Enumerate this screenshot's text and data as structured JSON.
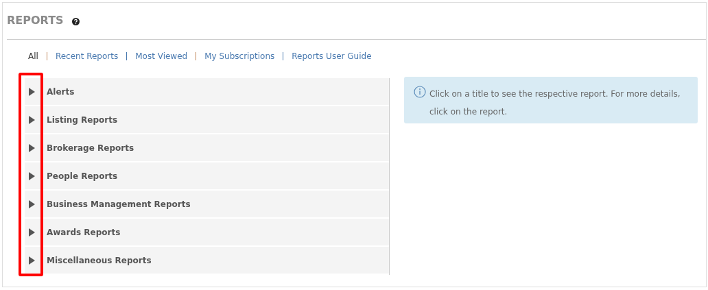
{
  "page": {
    "title": "REPORTS"
  },
  "tabs": [
    {
      "label": "All",
      "selected": true
    },
    {
      "label": "Recent Reports",
      "selected": false
    },
    {
      "label": "Most Viewed",
      "selected": false
    },
    {
      "label": "My Subscriptions",
      "selected": false
    },
    {
      "label": "Reports User Guide",
      "selected": false
    }
  ],
  "categories": [
    {
      "label": "Alerts",
      "expanded": false
    },
    {
      "label": "Listing Reports",
      "expanded": false
    },
    {
      "label": "Brokerage Reports",
      "expanded": false
    },
    {
      "label": "People Reports",
      "expanded": false
    },
    {
      "label": "Business Management Reports",
      "expanded": false
    },
    {
      "label": "Awards Reports",
      "expanded": false
    },
    {
      "label": "Miscellaneous Reports",
      "expanded": false
    }
  ],
  "info": {
    "message": "Click on a title to see the respective report. For more details, click on the report."
  }
}
